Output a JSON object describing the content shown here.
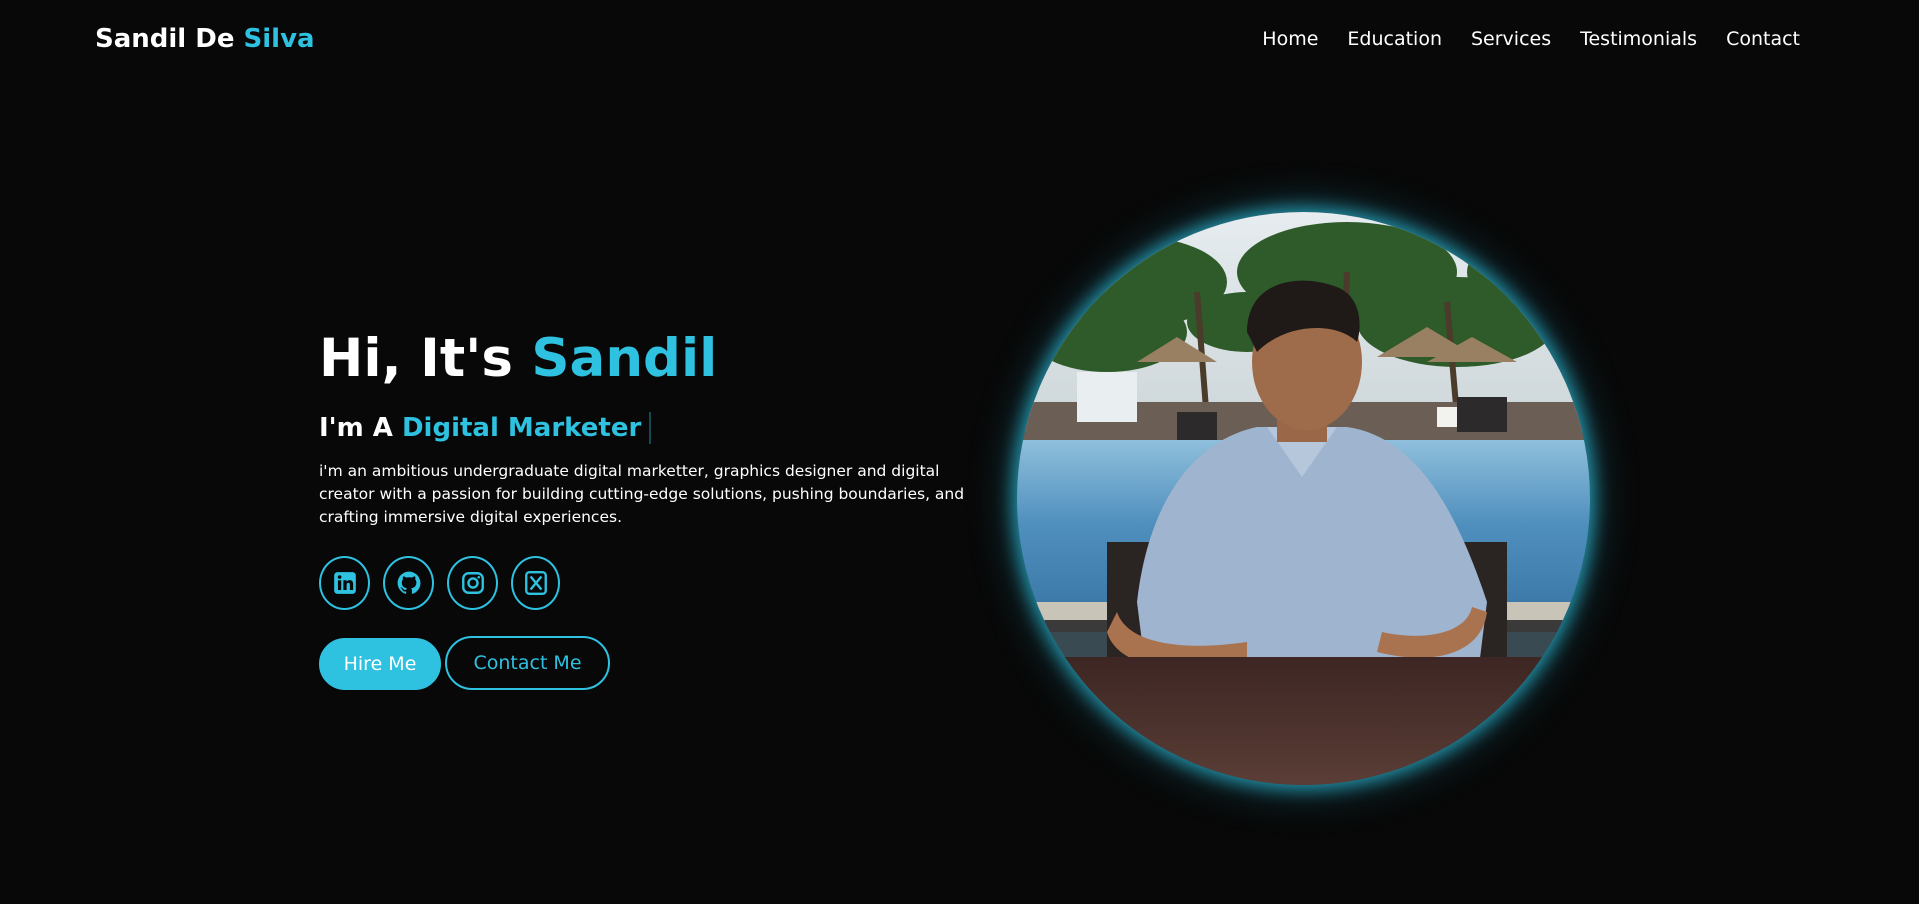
{
  "header": {
    "logo_first": "Sandil De ",
    "logo_accent": "Silva",
    "nav": [
      {
        "label": "Home"
      },
      {
        "label": "Education"
      },
      {
        "label": "Services"
      },
      {
        "label": "Testimonials"
      },
      {
        "label": "Contact"
      }
    ]
  },
  "hero": {
    "greeting": "Hi, It's ",
    "name": "Sandil",
    "role_prefix": "I'm A ",
    "role": "Digital Marketer",
    "description": "i'm an ambitious undergraduate digital marketter, graphics designer and digital creator with a passion for building cutting-edge solutions, pushing boundaries, and crafting immersive digital experiences.",
    "socials": [
      {
        "icon": "linkedin-icon"
      },
      {
        "icon": "github-icon"
      },
      {
        "icon": "instagram-icon"
      },
      {
        "icon": "x-twitter-icon"
      }
    ],
    "hire_label": "Hire Me",
    "contact_label": "Contact Me"
  },
  "colors": {
    "background": "#080808",
    "accent": "#2ec1e0",
    "text": "#ffffff"
  }
}
